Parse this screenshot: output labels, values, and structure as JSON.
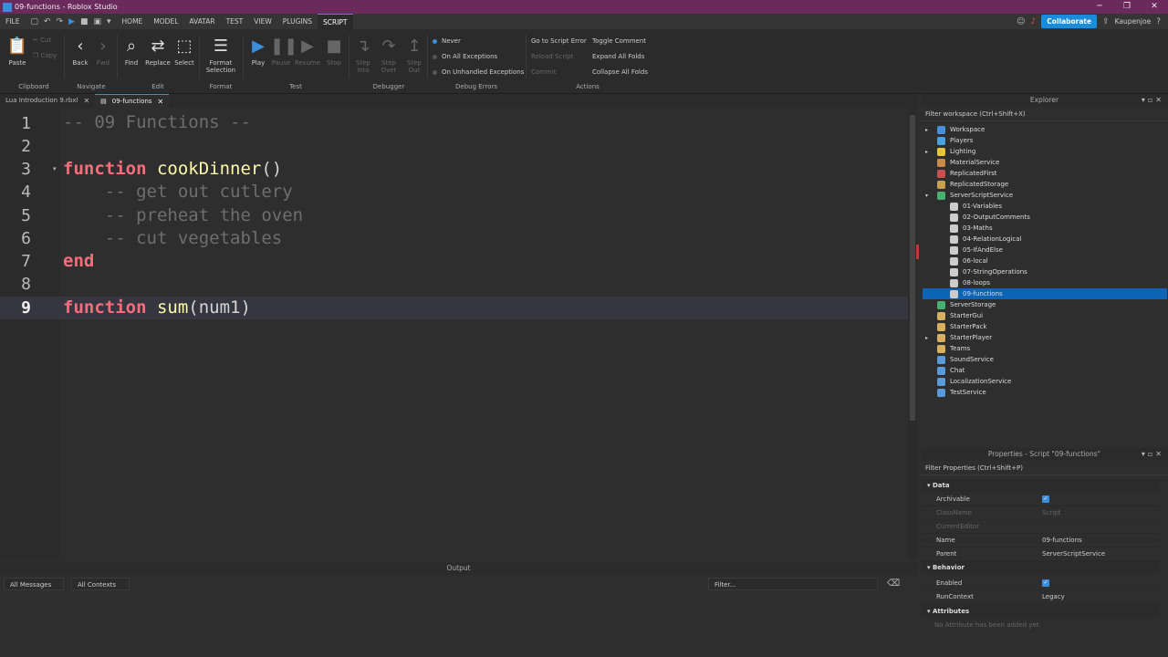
{
  "window": {
    "title": "09-functions - Roblox Studio"
  },
  "menu": {
    "file": "FILE",
    "tabs": [
      "HOME",
      "MODEL",
      "AVATAR",
      "TEST",
      "VIEW",
      "PLUGINS",
      "SCRIPT"
    ],
    "active_tab": "SCRIPT",
    "collaborate": "Collaborate",
    "user": "Kaupenjoe"
  },
  "ribbon": {
    "paste": "Paste",
    "cut": "Cut",
    "copy": "Copy",
    "back": "Back",
    "find": "Find",
    "replace": "Replace",
    "select": "Select",
    "format_selection": "Format Selection",
    "play": "Play",
    "pause": "Pause",
    "resume": "Resume",
    "stop": "Stop",
    "step_into": "Step Into",
    "step_over": "Step Over",
    "step_out": "Step Out",
    "never": "Never",
    "on_all_exceptions": "On All Exceptions",
    "on_unhandled_exceptions": "On Unhandled Exceptions",
    "go_to_script_error": "Go to Script Error",
    "reload_script": "Reload Script",
    "commit": "Commit",
    "toggle_comment": "Toggle Comment",
    "expand_all_folds": "Expand All Folds",
    "collapse_all_folds": "Collapse All Folds",
    "groups": [
      "Clipboard",
      "Navigate",
      "Edit",
      "Format",
      "Test",
      "Debugger",
      "Debug Errors",
      "Actions"
    ]
  },
  "editor_tabs": [
    {
      "label": "Lua Introduction 9.rbxl"
    },
    {
      "label": "09-functions"
    }
  ],
  "code": {
    "line_numbers": [
      "1",
      "2",
      "3",
      "4",
      "5",
      "6",
      "7",
      "8",
      "9"
    ],
    "l1": "-- 09 Functions --",
    "l3_kw": "function",
    "l3_name": "cookDinner",
    "l3_rest": "()",
    "l4": "    -- get out cutlery",
    "l5": "    -- preheat the oven",
    "l6": "    -- cut vegetables",
    "l7": "end",
    "l9_kw": "function",
    "l9_name": "sum",
    "l9_rest": "(num1)"
  },
  "output": {
    "title": "Output",
    "messages_filter": "All Messages",
    "contexts_filter": "All Contexts",
    "search_placeholder": "Filter..."
  },
  "explorer": {
    "title": "Explorer",
    "filter": "Filter workspace (Ctrl+Shift+X)",
    "items": [
      {
        "label": "Workspace",
        "color": "#4a90d9"
      },
      {
        "label": "Players",
        "color": "#4aa0e0"
      },
      {
        "label": "Lighting",
        "color": "#e8c63a"
      },
      {
        "label": "MaterialService",
        "color": "#c98a4a"
      },
      {
        "label": "ReplicatedFirst",
        "color": "#c95050"
      },
      {
        "label": "ReplicatedStorage",
        "color": "#c9a050"
      },
      {
        "label": "ServerScriptService",
        "color": "#4ab070"
      },
      {
        "label": "01-Variables",
        "color": "#cccccc"
      },
      {
        "label": "02-OutputComments",
        "color": "#cccccc"
      },
      {
        "label": "03-Maths",
        "color": "#cccccc"
      },
      {
        "label": "04-RelationLogical",
        "color": "#cccccc"
      },
      {
        "label": "05-IfAndElse",
        "color": "#cccccc"
      },
      {
        "label": "06-local",
        "color": "#cccccc"
      },
      {
        "label": "07-StringOperations",
        "color": "#cccccc"
      },
      {
        "label": "08-loops",
        "color": "#cccccc"
      },
      {
        "label": "09-functions",
        "color": "#cccccc"
      },
      {
        "label": "ServerStorage",
        "color": "#4ab070"
      },
      {
        "label": "StarterGui",
        "color": "#d8b060"
      },
      {
        "label": "StarterPack",
        "color": "#d8b060"
      },
      {
        "label": "StarterPlayer",
        "color": "#d8b060"
      },
      {
        "label": "Teams",
        "color": "#d8b060"
      },
      {
        "label": "SoundService",
        "color": "#5a9ad8"
      },
      {
        "label": "Chat",
        "color": "#5a9ad8"
      },
      {
        "label": "LocalizationService",
        "color": "#5a9ad8"
      },
      {
        "label": "TestService",
        "color": "#5a9ad8"
      }
    ]
  },
  "properties": {
    "title": "Properties - Script \"09-functions\"",
    "filter": "Filter Properties (Ctrl+Shift+P)",
    "data_section": "Data",
    "behavior_section": "Behavior",
    "attributes_section": "Attributes",
    "archivable": "Archivable",
    "classname": "ClassName",
    "classname_value": "Script",
    "current_editor": "CurrentEditor",
    "name": "Name",
    "name_value": "09-functions",
    "parent": "Parent",
    "parent_value": "ServerScriptService",
    "enabled": "Enabled",
    "run_context": "RunContext",
    "run_context_value": "Legacy",
    "no_attributes": "No Attribute has been added yet."
  }
}
